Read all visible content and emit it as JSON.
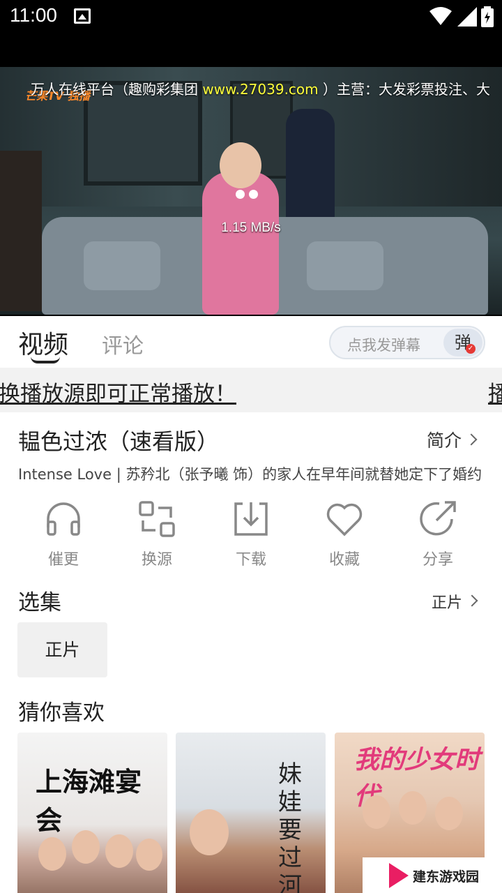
{
  "status_bar": {
    "time": "11:00",
    "icons": [
      "image-icon",
      "wifi-icon",
      "signal-icon",
      "battery-icon"
    ]
  },
  "player": {
    "ticker_text": "万人在线平台（趣购彩集团",
    "ticker_url": "www.27039.com",
    "ticker_tail": "）主营：大发彩票投注、大",
    "channel_logo": "芒果TV 独播",
    "speed": "1.15 MB/s"
  },
  "tabs": {
    "video": "视频",
    "comment": "评论"
  },
  "danmu": {
    "placeholder": "点我发弹幕",
    "button": "弹"
  },
  "notice": {
    "text": "换播放源即可正常播放！",
    "text_next": "播"
  },
  "info": {
    "title": "韫色过浓（速看版）",
    "intro_label": "简介",
    "description": "Intense Love | 苏矜北（张予曦 饰）的家人在早年间就替她定下了婚约"
  },
  "actions": [
    {
      "label": "催更",
      "icon": "headphones-icon"
    },
    {
      "label": "换源",
      "icon": "switch-source-icon"
    },
    {
      "label": "下载",
      "icon": "download-icon"
    },
    {
      "label": "收藏",
      "icon": "heart-icon"
    },
    {
      "label": "分享",
      "icon": "share-icon"
    }
  ],
  "episodes": {
    "title": "选集",
    "current": "正片",
    "items": [
      "正片"
    ]
  },
  "recommend": {
    "title": "猜你喜欢",
    "posters": [
      {
        "caption": "上海滩宴会"
      },
      {
        "caption": "妹娃要过河"
      },
      {
        "caption": "我的少女时代"
      }
    ]
  },
  "watermark": {
    "text": "建东游戏园"
  },
  "colors": {
    "accent_red": "#e53935",
    "ticker_yellow": "#ffff3b"
  }
}
